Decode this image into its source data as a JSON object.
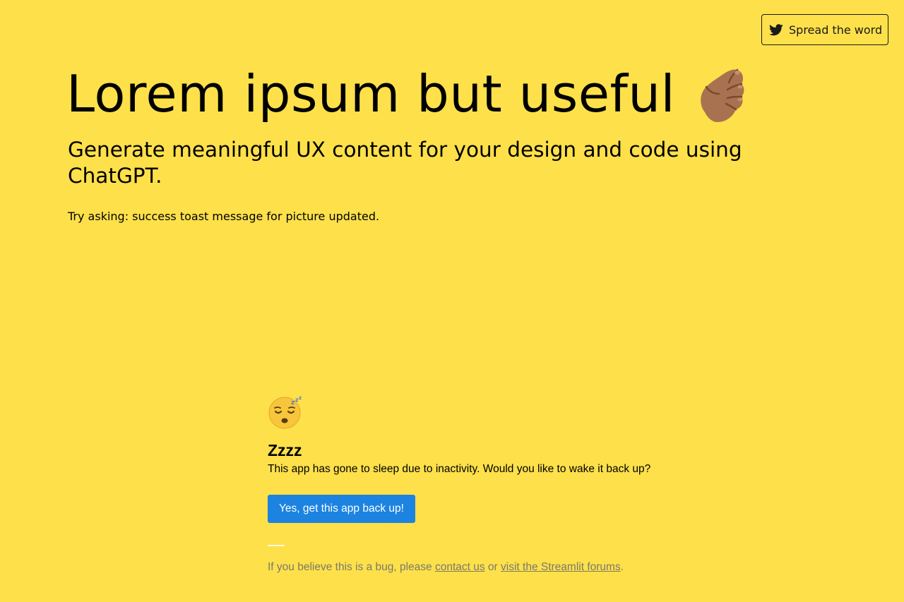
{
  "header": {
    "share_button_label": "Spread the word",
    "share_icon": "twitter-icon"
  },
  "hero": {
    "title": "Lorem ipsum but useful",
    "title_icon": "pinched-fingers-icon",
    "subtitle": "Generate meaningful UX content for your design and code using ChatGPT.",
    "hint": "Try asking: success toast message for picture updated."
  },
  "sleep_notice": {
    "icon": "sleeping-face-icon",
    "title": "Zzzz",
    "message": "This app has gone to sleep due to inactivity. Would you like to wake it back up?",
    "wake_button_label": "Yes, get this app back up!",
    "bug_prefix": "If you believe this is a bug, please ",
    "contact_link": "contact us",
    "or_text": " or ",
    "forums_link": "visit the Streamlit forums",
    "suffix": "."
  },
  "colors": {
    "background": "#FEE04A",
    "button_blue": "#1c83e1",
    "muted_text": "#7a7a6a"
  }
}
